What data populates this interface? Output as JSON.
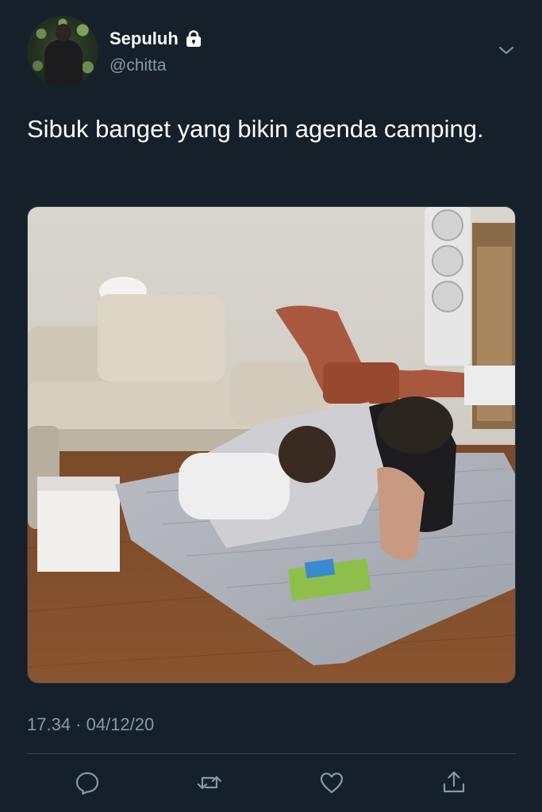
{
  "user": {
    "display_name": "Sepuluh",
    "handle": "@chitta",
    "avatar_icon": "profile-photo",
    "protected_icon": "lock-icon"
  },
  "tweet": {
    "text": "Sibuk banget yang bikin agenda camping.",
    "media_description_icon": "photo",
    "timestamp": "17.34 · 04/12/20"
  },
  "actions": [
    {
      "name": "reply",
      "icon": "reply-icon"
    },
    {
      "name": "retweet",
      "icon": "retweet-icon"
    },
    {
      "name": "like",
      "icon": "heart-icon"
    },
    {
      "name": "share",
      "icon": "share-icon"
    }
  ],
  "colors": {
    "background": "#15202b",
    "text_primary": "#ffffff",
    "text_secondary": "#8899a6",
    "divider": "#38444d"
  }
}
